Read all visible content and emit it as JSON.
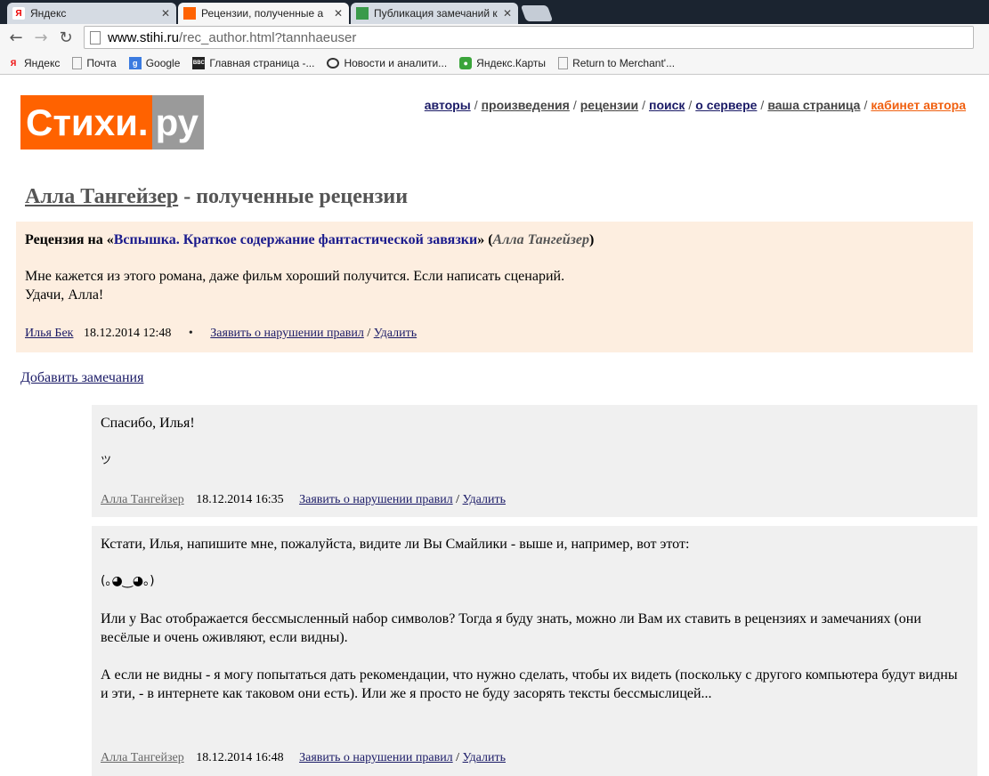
{
  "browser": {
    "tabs": [
      {
        "title": "Яндекс",
        "active": false
      },
      {
        "title": "Рецензии, полученные а",
        "active": true
      },
      {
        "title": "Публикация замечаний к",
        "active": false
      }
    ],
    "url_host": "www.stihi.ru",
    "url_path": "/rec_author.html?tannhaeuser",
    "bookmarks": [
      "Яндекс",
      "Почта",
      "Google",
      "Главная страница -...",
      "Новости и аналити...",
      "Яндекс.Карты",
      "Return to Merchant'..."
    ]
  },
  "site": {
    "logo_main": "Стихи",
    "logo_dot": ".",
    "logo_tld": "ру",
    "nav": [
      "авторы",
      "произведения",
      "рецензии",
      "поиск",
      "о сервере",
      "ваша страница",
      "кабинет автора"
    ]
  },
  "page": {
    "author_name": "Алла Тангейзер",
    "title_suffix": " - полученные рецензии"
  },
  "review": {
    "prefix": "Рецензия на «",
    "work_title": "Вспышка. Краткое содержание фантастической завязки",
    "mid": "» (",
    "work_author": "Алла Тангейзер",
    "suffix": ")",
    "line1": "Мне кажется из этого романа, даже фильм хороший получится. Если написать сценарий.",
    "line2": "Удачи, Алла!",
    "reviewer": "Илья Бек",
    "date": "18.12.2014 12:48",
    "bullet": "•",
    "report": "Заявить о нарушении правил",
    "slash": "/",
    "delete": "Удалить"
  },
  "add_note": "Добавить замечания",
  "replies": [
    {
      "p1": "Спасибо, Илья!",
      "p2": "ツ",
      "author": "Алла Тангейзер",
      "date": "18.12.2014 16:35",
      "report": "Заявить о нарушении правил",
      "slash": "/",
      "delete": "Удалить"
    },
    {
      "p1": "Кстати, Илья, напишите мне, пожалуйста, видите ли Вы Смайлики - выше и, например, вот этот:",
      "p2": "(｡◕‿◕｡)",
      "p3": "Или у Вас отображается бессмысленный набор символов? Тогда я буду знать, можно ли Вам их ставить в рецензиях и замечаниях (они весёлые и очень оживляют, если видны).",
      "p4": "А если не видны - я могу попытаться дать рекомендации, что нужно сделать, чтобы их видеть (поскольку с другого компьютера будут видны и эти, - в интернете как таковом они есть). Или же я просто не буду засорять тексты бессмыслицей...",
      "author": "Алла Тангейзер",
      "date": "18.12.2014 16:48",
      "report": "Заявить о нарушении правил",
      "slash": "/",
      "delete": "Удалить"
    }
  ],
  "colors": {
    "accent": "#ff6200",
    "review_bg": "#fdeee0",
    "reply_bg": "#f0f0f0",
    "link": "#1a1a66"
  }
}
